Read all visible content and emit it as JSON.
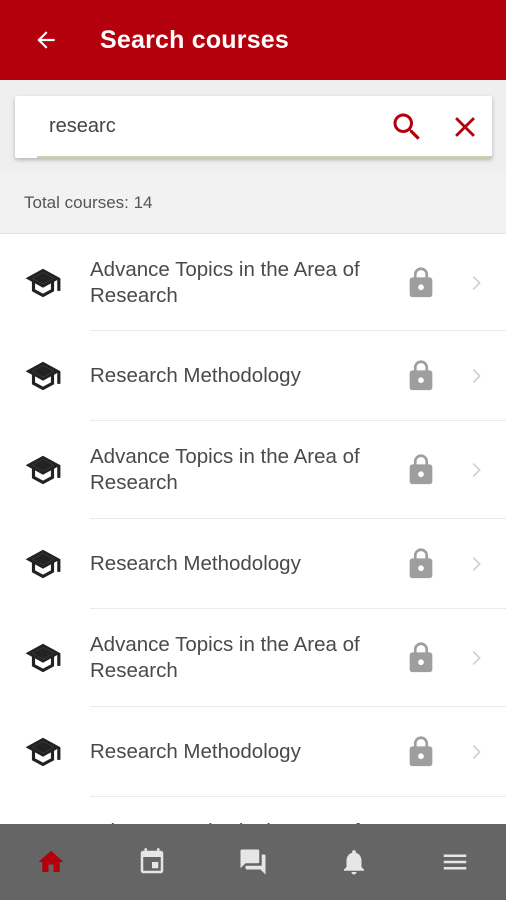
{
  "appbar": {
    "title": "Search courses"
  },
  "search": {
    "value": "researc"
  },
  "summary": {
    "total": "Total courses: 14"
  },
  "courses": [
    {
      "title": "Advance Topics in the Area of Research",
      "locked": true
    },
    {
      "title": "Research Methodology",
      "locked": true
    },
    {
      "title": "Advance Topics in the Area of Research",
      "locked": true
    },
    {
      "title": "Research Methodology",
      "locked": true
    },
    {
      "title": "Advance Topics in the Area of Research",
      "locked": true
    },
    {
      "title": "Research Methodology",
      "locked": true
    },
    {
      "title": "Advance Topics in the Area of Research",
      "locked": true
    }
  ],
  "bottom_nav": {
    "items": [
      {
        "icon": "home-icon",
        "active": true
      },
      {
        "icon": "calendar-icon",
        "active": false
      },
      {
        "icon": "chat-icon",
        "active": false
      },
      {
        "icon": "bell-icon",
        "active": false
      },
      {
        "icon": "menu-icon",
        "active": false
      }
    ]
  },
  "colors": {
    "primary": "#b3000c",
    "nav_background": "#656565",
    "nav_active": "#b3000c",
    "nav_inactive": "#e6e6e6",
    "icon_gray": "#9e9e9e",
    "chevron": "#cfcfcf"
  }
}
